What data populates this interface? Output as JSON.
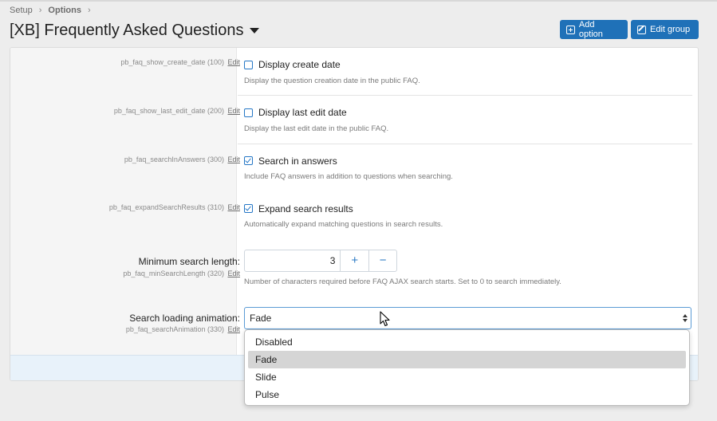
{
  "breadcrumb": [
    "Setup",
    "Options"
  ],
  "page": {
    "title": "[XB] Frequently Asked Questions"
  },
  "buttons": {
    "add_option": "Add option",
    "edit_group": "Edit group"
  },
  "edit_link": "Edit",
  "options": [
    {
      "key": "pb_faq_show_create_date (100)",
      "label": "Display create date",
      "checked": false,
      "description": "Display the question creation date in the public FAQ."
    },
    {
      "key": "pb_faq_show_last_edit_date (200)",
      "label": "Display last edit date",
      "checked": false,
      "description": "Display the last edit date in the public FAQ."
    },
    {
      "key": "pb_faq_searchInAnswers (300)",
      "label": "Search in answers",
      "checked": true,
      "description": "Include FAQ answers in addition to questions when searching."
    },
    {
      "key": "pb_faq_expandSearchResults (310)",
      "label": "Expand search results",
      "checked": true,
      "description": "Automatically expand matching questions in search results."
    }
  ],
  "min_search": {
    "label": "Minimum search length:",
    "key": "pb_faq_minSearchLength (320)",
    "value": "3",
    "plus": "+",
    "minus": "−",
    "description": "Number of characters required before FAQ AJAX search starts. Set to 0 to search immediately."
  },
  "search_animation": {
    "label": "Search loading animation:",
    "key": "pb_faq_searchAnimation (330)",
    "selected": "Fade",
    "options": [
      "Disabled",
      "Fade",
      "Slide",
      "Pulse"
    ]
  },
  "colors": {
    "accent": "#1f71b8",
    "checkbox": "#2577c6",
    "footer": "#e8f2fa"
  }
}
